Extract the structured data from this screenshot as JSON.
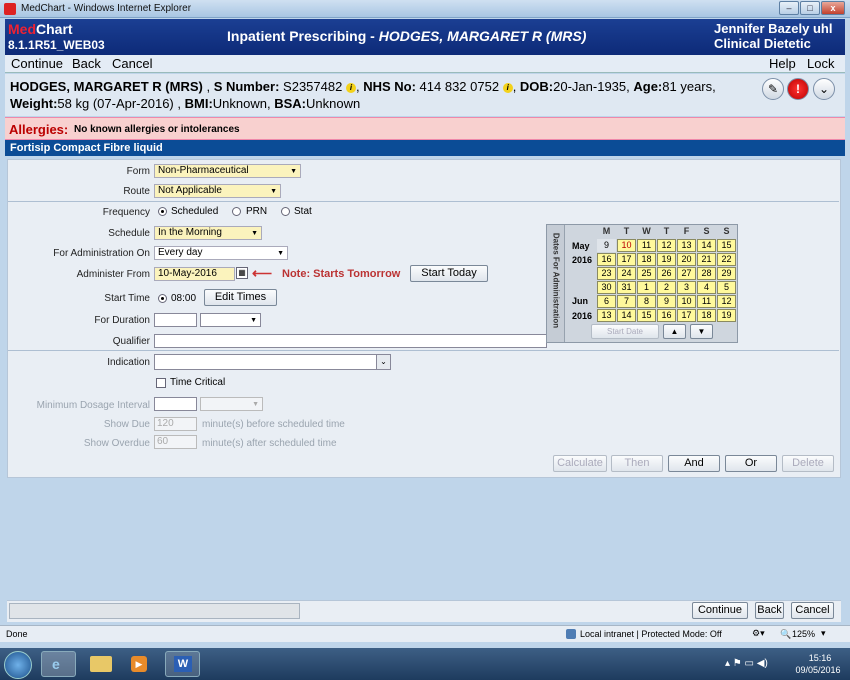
{
  "window": {
    "title": "MedChart - Windows Internet Explorer",
    "min": "–",
    "max": "□",
    "close": "x"
  },
  "header": {
    "logo_med": "Med",
    "logo_chart": "Chart",
    "version": "8.1.1R51_WEB03",
    "title_prefix": "Inpatient Prescribing - ",
    "title_patient": "HODGES, MARGARET R (MRS)",
    "user_name": "Jennifer Bazely uhl",
    "user_role": "Clinical Dietetic"
  },
  "menu": {
    "continue": "Continue",
    "back": "Back",
    "cancel": "Cancel",
    "help": "Help",
    "lock": "Lock"
  },
  "patient": {
    "name": "HODGES, MARGARET R (MRS)",
    "s_label": "S Number:",
    "s_number": "S2357482",
    "nhs_label": "NHS No:",
    "nhs": "414 832 0752",
    "dob_label": "DOB:",
    "dob": "20-Jan-1935",
    "age_label": "Age:",
    "age": "81 years",
    "weight_label": "Weight:",
    "weight": "58 kg (07-Apr-2016)",
    "bmi_label": "BMI:",
    "bmi": "Unknown",
    "bsa_label": "BSA:",
    "bsa": "Unknown",
    "info_icon": "i"
  },
  "allergies": {
    "label": "Allergies:",
    "value": "No known allergies or intolerances"
  },
  "drug": {
    "name": "Fortisip Compact Fibre liquid"
  },
  "form": {
    "form_label": "Form",
    "form_value": "Non-Pharmaceutical",
    "route_label": "Route",
    "route_value": "Not Applicable",
    "frequency_label": "Frequency",
    "freq_scheduled": "Scheduled",
    "freq_prn": "PRN",
    "freq_stat": "Stat",
    "schedule_label": "Schedule",
    "schedule_value": "In the Morning",
    "admin_on_label": "For Administration On",
    "admin_on_value": "Every day",
    "admin_from_label": "Administer From",
    "admin_from_value": "10-May-2016",
    "note": "Note: Starts Tomorrow",
    "start_today": "Start Today",
    "start_time_label": "Start Time",
    "start_time_value": "08:00",
    "edit_times": "Edit Times",
    "duration_label": "For Duration",
    "qualifier_label": "Qualifier",
    "indication_label": "Indication",
    "time_critical": "Time Critical",
    "min_dose_label": "Minimum Dosage Interval",
    "show_due_label": "Show Due",
    "show_due_value": "120",
    "show_due_suffix": "minute(s) before scheduled time",
    "show_overdue_label": "Show Overdue",
    "show_overdue_value": "60",
    "show_overdue_suffix": "minute(s) after scheduled time",
    "btn_calculate": "Calculate",
    "btn_then": "Then",
    "btn_and": "And",
    "btn_or": "Or",
    "btn_delete": "Delete"
  },
  "calendar": {
    "side_label": "Dates For Administration",
    "days": [
      "M",
      "T",
      "W",
      "T",
      "F",
      "S",
      "S"
    ],
    "month1": "May",
    "year1": "2016",
    "month2": "Jun",
    "year2": "2016",
    "rows": [
      [
        "9",
        "10",
        "11",
        "12",
        "13",
        "14",
        "15"
      ],
      [
        "16",
        "17",
        "18",
        "19",
        "20",
        "21",
        "22"
      ],
      [
        "23",
        "24",
        "25",
        "26",
        "27",
        "28",
        "29"
      ],
      [
        "30",
        "31",
        "1",
        "2",
        "3",
        "4",
        "5"
      ],
      [
        "6",
        "7",
        "8",
        "9",
        "10",
        "11",
        "12"
      ],
      [
        "13",
        "14",
        "15",
        "16",
        "17",
        "18",
        "19"
      ]
    ],
    "start_date": "Start Date",
    "up": "▲",
    "down": "▼"
  },
  "footer": {
    "continue": "Continue",
    "back": "Back",
    "cancel": "Cancel"
  },
  "ie_status": {
    "done": "Done",
    "zone": "Local intranet | Protected Mode: Off",
    "zoom": "125%"
  },
  "taskbar": {
    "time": "15:16",
    "date": "09/05/2016"
  }
}
